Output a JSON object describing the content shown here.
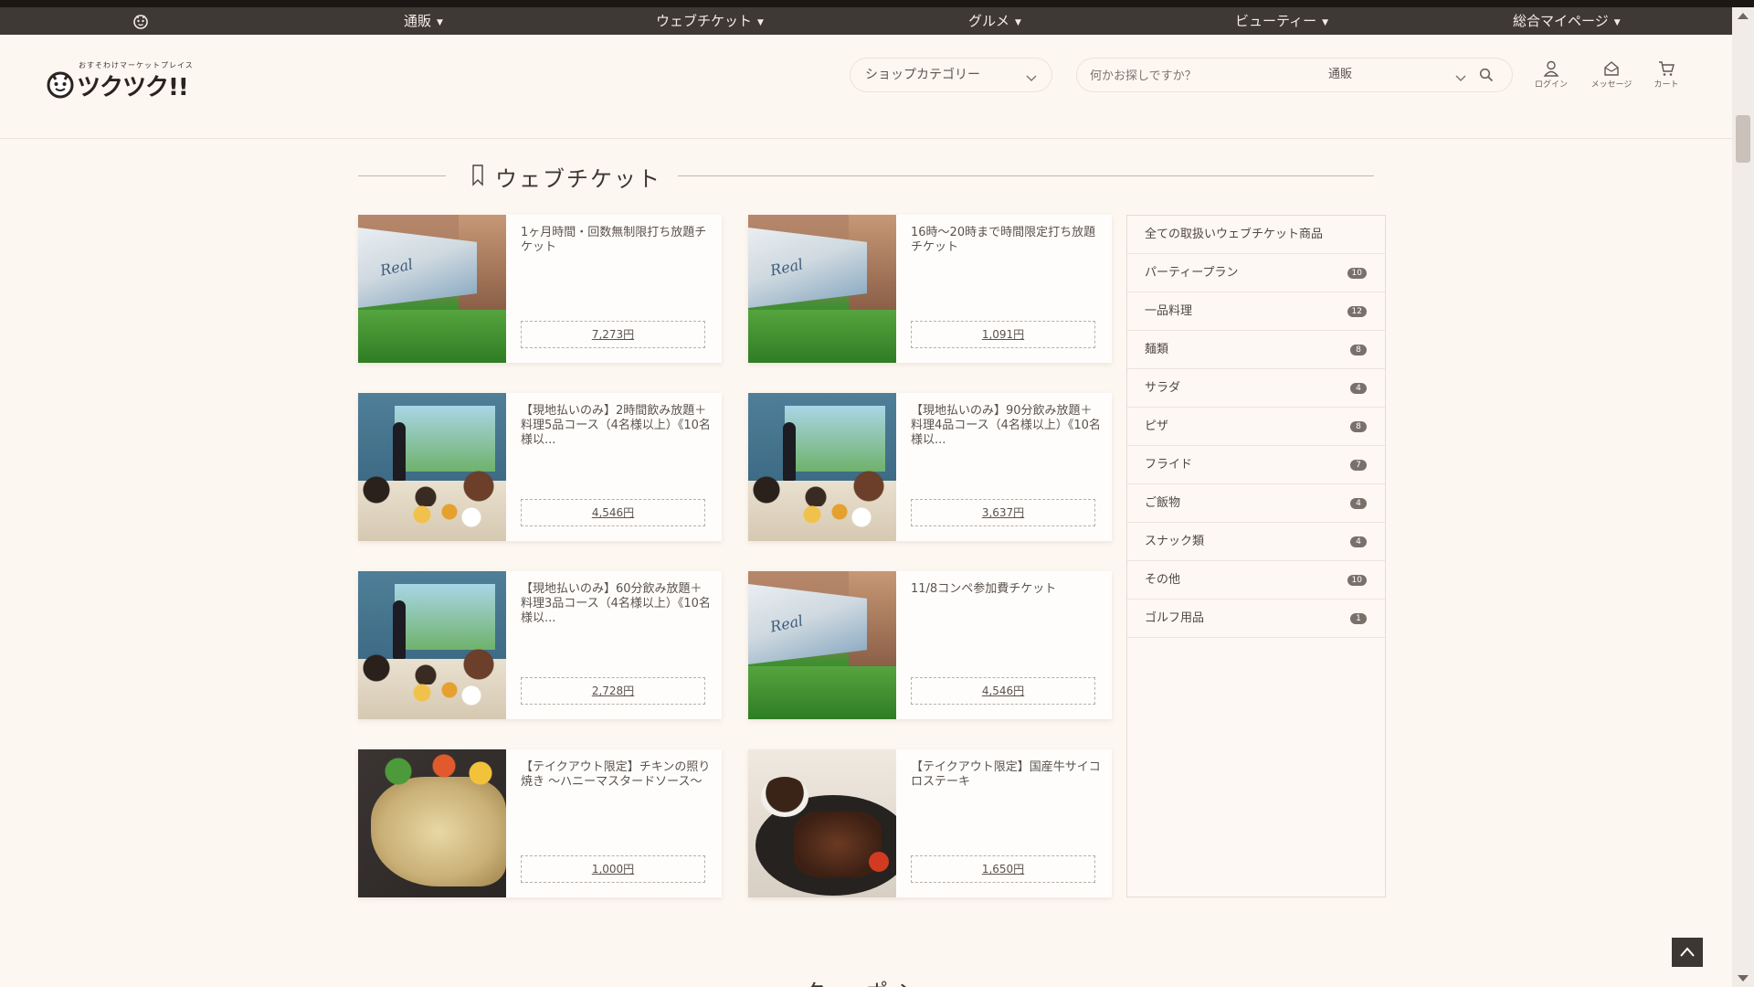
{
  "nav": {
    "items": [
      {
        "label": "通販"
      },
      {
        "label": "ウェブチケット"
      },
      {
        "label": "グルメ"
      },
      {
        "label": "ビューティー"
      },
      {
        "label": "総合マイページ"
      }
    ]
  },
  "header": {
    "logo_tagline": "おすそわけマーケットプレイス",
    "logo_text": "ツクツク!!",
    "category_select": "ショップカテゴリー",
    "search_placeholder": "何かお探しですか？",
    "search_scope": "通販",
    "login_label": "ログイン",
    "message_label": "メッセージ",
    "cart_label": "カート"
  },
  "section": {
    "title": "ウェブチケット"
  },
  "products": [
    {
      "name": "1ヶ月時間・回数無制限打ち放題チケット",
      "price": "7,273円",
      "image": "golf-simulator"
    },
    {
      "name": "16時〜20時まで時間限定打ち放題チケット",
      "price": "1,091円",
      "image": "golf-simulator"
    },
    {
      "name": "【現地払いのみ】2時間飲み放題＋料理5品コース（4名様以上）《10名様以...",
      "price": "4,546円",
      "image": "party"
    },
    {
      "name": "【現地払いのみ】90分飲み放題＋料理4品コース（4名様以上）《10名様以...",
      "price": "3,637円",
      "image": "party"
    },
    {
      "name": "【現地払いのみ】60分飲み放題＋料理3品コース（4名様以上）《10名様以...",
      "price": "2,728円",
      "image": "party"
    },
    {
      "name": "11/8コンペ参加費チケット",
      "price": "4,546円",
      "image": "golf-simulator"
    },
    {
      "name": "【テイクアウト限定】チキンの照り焼き 〜ハニーマスタードソース〜",
      "price": "1,000円",
      "image": "chicken"
    },
    {
      "name": "【テイクアウト限定】国産牛サイコロステーキ",
      "price": "1,650円",
      "image": "steak"
    }
  ],
  "sidebar": {
    "all_label": "全ての取扱いウェブチケット商品",
    "categories": [
      {
        "label": "パーティープラン",
        "count": "10"
      },
      {
        "label": "一品料理",
        "count": "12"
      },
      {
        "label": "麺類",
        "count": "8"
      },
      {
        "label": "サラダ",
        "count": "4"
      },
      {
        "label": "ピザ",
        "count": "8"
      },
      {
        "label": "フライド",
        "count": "7"
      },
      {
        "label": "ご飯物",
        "count": "4"
      },
      {
        "label": "スナック類",
        "count": "4"
      },
      {
        "label": "その他",
        "count": "10"
      },
      {
        "label": "ゴルフ用品",
        "count": "1"
      }
    ]
  },
  "next_section_title": "クーポン",
  "colors": {
    "background": "#fdf7f1",
    "navbar": "#3f3936",
    "badge": "#7a706a"
  }
}
